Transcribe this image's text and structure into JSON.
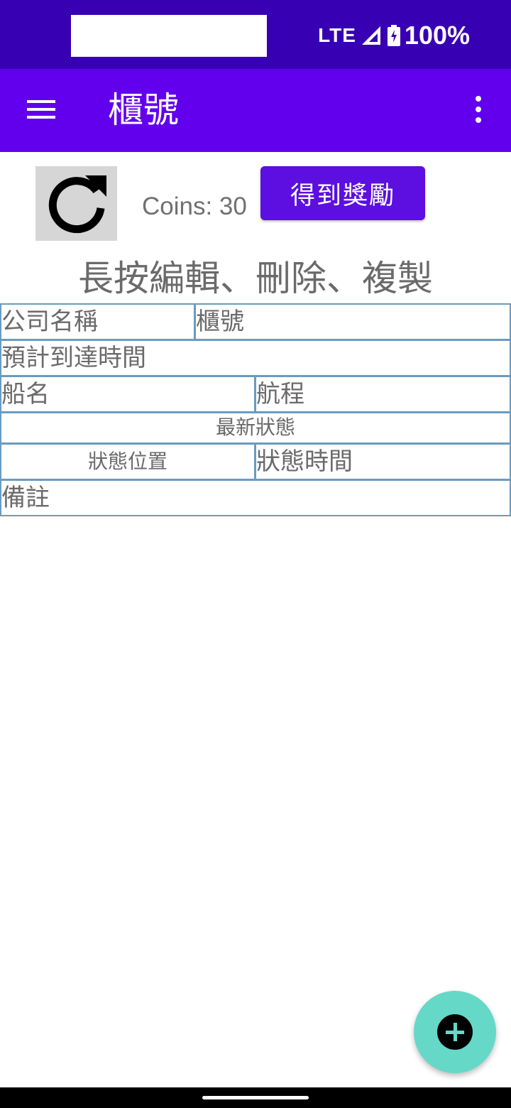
{
  "status_bar": {
    "network": "LTE",
    "battery": "100%"
  },
  "app_bar": {
    "title": "櫃號",
    "menu_icon": "hamburger-menu-icon",
    "more_icon": "more-vert-icon"
  },
  "controls": {
    "refresh_icon": "refresh-icon",
    "coins_label": "Coins: 30",
    "reward_button": "得到獎勵"
  },
  "hint": "長按編輯、刪除、複製",
  "table": {
    "company_name": "公司名稱",
    "container_no": "櫃號",
    "eta": "預計到達時間",
    "ship_name": "船名",
    "voyage": "航程",
    "latest_status": "最新狀態",
    "status_location": "狀態位置",
    "status_time": "狀態時間",
    "remarks": "備註"
  },
  "fab": {
    "icon": "add-icon"
  },
  "colors": {
    "status_bar": "#3700b3",
    "app_bar": "#6200ee",
    "button": "#5c0fe0",
    "fab": "#66d8c8",
    "table_border": "#6a9bbf"
  }
}
